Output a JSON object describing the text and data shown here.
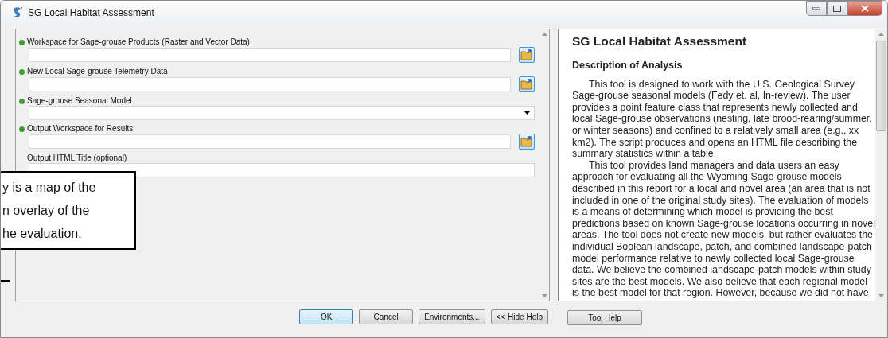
{
  "window": {
    "title": "SG Local Habitat Assessment"
  },
  "parameters": [
    {
      "label": "Workspace for Sage-grouse Products (Raster and Vector Data)",
      "required": true,
      "kind": "folder"
    },
    {
      "label": "New Local Sage-grouse Telemetry Data",
      "required": true,
      "kind": "folder"
    },
    {
      "label": "Sage-grouse Seasonal Model",
      "required": true,
      "kind": "dropdown"
    },
    {
      "label": "Output Workspace for Results",
      "required": true,
      "kind": "folder"
    },
    {
      "label": "Output HTML Title (optional)",
      "required": false,
      "kind": "text"
    }
  ],
  "callout": {
    "lines": [
      "y is a map of the",
      "n overlay of the",
      "he evaluation."
    ]
  },
  "help": {
    "title": "SG Local Habitat Assessment",
    "heading": "Description of Analysis",
    "paragraphs": [
      [
        "This tool is designed to work with the U.S. Geological Survey",
        "Sage-grouse seasonal models (Fedy et. al, In-review). The user",
        "provides a point feature class that represents newly collected and",
        "local Sage-grouse observations (nesting, late brood-rearing/summer,",
        "or winter seasons) and confined to a relatively small area (e.g., xx",
        "km2). The script produces and opens an HTML file describing the",
        "summary statistics within a table."
      ],
      [
        "This tool provides land managers and data users an easy",
        "approach for evaluating all the Wyoming Sage-grouse models",
        "described in this report for a local and novel area (an area that is not",
        "included in one of the original study sites). The evaluation of models",
        "is a means of determining which model is providing the best",
        "predictions based on known Sage-grouse locations occurring in novel",
        "areas. The tool does not create new models, but rather evaluates the",
        "individual Boolean landscape, patch, and combined landscape-patch",
        "model performance relative to newly collected local Sage-grouse",
        "data. We believe the combined landscape-patch models within study",
        "sites are the best models. We also believe that each regional model",
        "is the best model for that region. However, because we did not have"
      ]
    ]
  },
  "buttons": [
    {
      "label": "OK",
      "default": true
    },
    {
      "label": "Cancel",
      "default": false
    },
    {
      "label": "Environments...",
      "default": false
    },
    {
      "label": "<< Hide Help",
      "default": false
    }
  ],
  "help_button": "Tool Help"
}
